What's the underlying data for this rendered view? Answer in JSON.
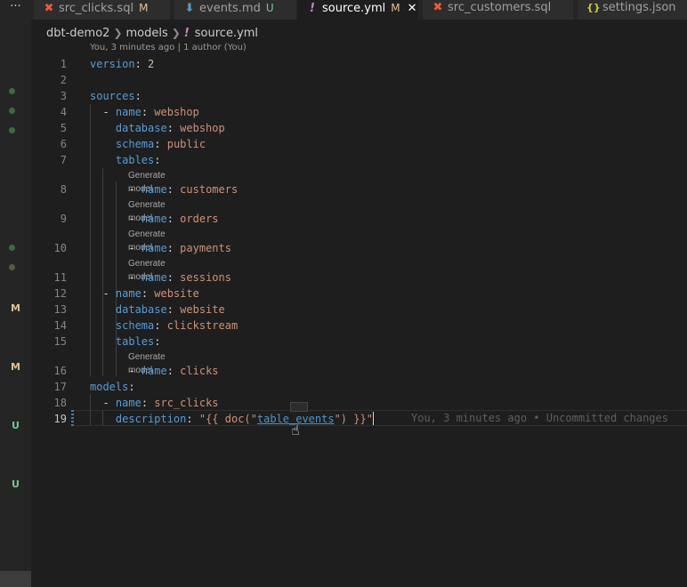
{
  "sidebar": {
    "more_label": "···",
    "marks": [
      {
        "label": "M",
        "color": "#e2c08d"
      },
      {
        "label": "M",
        "color": "#e2c08d"
      },
      {
        "label": "U",
        "color": "#73c991"
      },
      {
        "label": "U",
        "color": "#73c991"
      }
    ]
  },
  "tabs": [
    {
      "name": "src_clicks.sql",
      "status": "M",
      "icon": "dbt-icon",
      "icon_glyph": "✖",
      "icon_color": "#f0593a",
      "status_color": "#e2c08d",
      "active": false
    },
    {
      "name": "events.md",
      "status": "U",
      "icon": "markdown-icon",
      "icon_glyph": "⬇",
      "icon_color": "#519aba",
      "status_color": "#73c991",
      "active": false
    },
    {
      "name": "source.yml",
      "status": "M",
      "icon": "yaml-icon",
      "icon_glyph": "!",
      "icon_color": "#c586c0",
      "status_color": "#e2c08d",
      "active": true,
      "close": "✕"
    },
    {
      "name": "src_customers.sql",
      "status": "",
      "icon": "dbt-icon",
      "icon_glyph": "✖",
      "icon_color": "#f0593a",
      "status_color": "",
      "active": false
    },
    {
      "name": "settings.json",
      "status": "",
      "icon": "json-icon",
      "icon_glyph": "{}",
      "icon_color": "#cbcb41",
      "status_color": "",
      "active": false
    }
  ],
  "breadcrumb": {
    "parts": [
      "dbt-demo2",
      "models",
      "source.yml"
    ],
    "file_icon": "!"
  },
  "blame_header": "You, 3 minutes ago | 1 author (You)",
  "code_lens": "Generate model",
  "inline_blame": "You, 3 minutes ago • Uncommitted changes",
  "lines": [
    {
      "no": "1",
      "key": "version",
      "sep": ": ",
      "val": "2",
      "val_type": "num",
      "indent": ""
    },
    {
      "no": "2"
    },
    {
      "no": "3",
      "key": "sources",
      "sep": ":",
      "val": "",
      "indent": ""
    },
    {
      "no": "4",
      "dash": "- ",
      "key": "name",
      "sep": ": ",
      "val": "webshop",
      "indent": "  "
    },
    {
      "no": "5",
      "key": "database",
      "sep": ": ",
      "val": "webshop",
      "indent": "    "
    },
    {
      "no": "6",
      "key": "schema",
      "sep": ": ",
      "val": "public",
      "indent": "    "
    },
    {
      "no": "7",
      "key": "tables",
      "sep": ":",
      "val": "",
      "indent": "    "
    },
    {
      "no": "8",
      "dash": "- ",
      "key": "name",
      "sep": ": ",
      "val": "customers",
      "indent": "      "
    },
    {
      "no": "9",
      "dash": "- ",
      "key": "name",
      "sep": ": ",
      "val": "orders",
      "indent": "      "
    },
    {
      "no": "10",
      "dash": "- ",
      "key": "name",
      "sep": ": ",
      "val": "payments",
      "indent": "      "
    },
    {
      "no": "11",
      "dash": "- ",
      "key": "name",
      "sep": ": ",
      "val": "sessions",
      "indent": "      "
    },
    {
      "no": "12",
      "dash": "- ",
      "key": "name",
      "sep": ": ",
      "val": "website",
      "indent": "  "
    },
    {
      "no": "13",
      "key": "database",
      "sep": ": ",
      "val": "website",
      "indent": "    "
    },
    {
      "no": "14",
      "key": "schema",
      "sep": ": ",
      "val": "clickstream",
      "indent": "    "
    },
    {
      "no": "15",
      "key": "tables",
      "sep": ":",
      "val": "",
      "indent": "    "
    },
    {
      "no": "16",
      "dash": "- ",
      "key": "name",
      "sep": ": ",
      "val": "clicks",
      "indent": "      "
    },
    {
      "no": "17",
      "key": "models",
      "sep": ":",
      "val": "",
      "indent": ""
    },
    {
      "no": "18",
      "dash": "- ",
      "key": "name",
      "sep": ": ",
      "val": "src_clicks",
      "indent": "  "
    },
    {
      "no": "19",
      "key": "description",
      "sep": ": ",
      "indent": "    ",
      "val_pre": "\"{{ doc(\"",
      "val_link": "table_events",
      "val_post": "\") }}\""
    }
  ]
}
